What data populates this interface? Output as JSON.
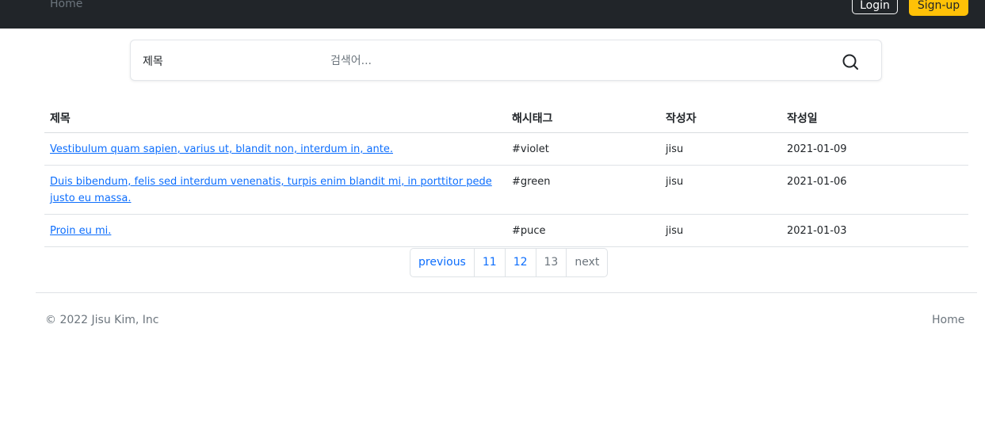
{
  "navbar": {
    "home_label": "Home",
    "login_label": "Login",
    "signup_label": "Sign-up",
    "signup_color": "#ffc107"
  },
  "search": {
    "type_label": "제목",
    "placeholder": "검색어...",
    "icon": "search-icon"
  },
  "table": {
    "headers": [
      "제목",
      "해시태그",
      "작성자",
      "작성일"
    ],
    "rows": [
      {
        "title": "Vestibulum quam sapien, varius ut, blandit non, interdum in, ante.",
        "hashtag": "#violet",
        "author": "jisu",
        "date": "2021-01-09"
      },
      {
        "title": "Duis bibendum, felis sed interdum venenatis, turpis enim blandit mi, in porttitor pede justo eu massa.",
        "hashtag": "#green",
        "author": "jisu",
        "date": "2021-01-06"
      },
      {
        "title": "Proin eu mi.",
        "hashtag": "#puce",
        "author": "jisu",
        "date": "2021-01-03"
      }
    ]
  },
  "pagination": {
    "previous": "previous",
    "pages": [
      "11",
      "12",
      "13"
    ],
    "next": "next"
  },
  "footer": {
    "copyright": "© 2022 Jisu Kim, Inc",
    "home_label": "Home"
  }
}
